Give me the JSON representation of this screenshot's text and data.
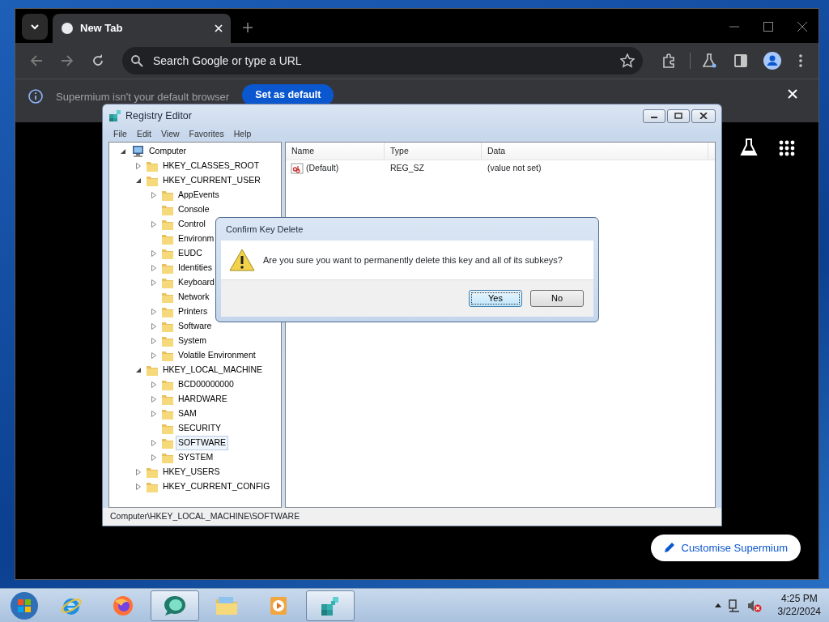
{
  "browser": {
    "tabs": [
      {
        "label": "New Tab",
        "selected": true
      }
    ],
    "omnibox": {
      "placeholder": "Search Google or type a URL"
    },
    "infobar": {
      "message": "Supermium isn't your default browser",
      "button": "Set as default"
    },
    "customise_button": "Customise Supermium"
  },
  "regedit": {
    "title": "Registry Editor",
    "menu": [
      "File",
      "Edit",
      "View",
      "Favorites",
      "Help"
    ],
    "tree": [
      {
        "label": "Computer",
        "kind": "computer",
        "expanded": true,
        "selected": false,
        "children": [
          {
            "label": "HKEY_CLASSES_ROOT",
            "expanded": false,
            "selected": false
          },
          {
            "label": "HKEY_CURRENT_USER",
            "expanded": true,
            "selected": false,
            "children": [
              {
                "label": "AppEvents",
                "expanded": false,
                "selected": false
              },
              {
                "label": "Console",
                "selected": false
              },
              {
                "label": "Control",
                "expanded": false,
                "selected": false
              },
              {
                "label": "Environm",
                "selected": false
              },
              {
                "label": "EUDC",
                "expanded": false,
                "selected": false
              },
              {
                "label": "Identities",
                "expanded": false,
                "selected": false
              },
              {
                "label": "Keyboard",
                "expanded": false,
                "selected": false
              },
              {
                "label": "Network",
                "selected": false
              },
              {
                "label": "Printers",
                "expanded": false,
                "selected": false
              },
              {
                "label": "Software",
                "expanded": false,
                "selected": false
              },
              {
                "label": "System",
                "expanded": false,
                "selected": false
              },
              {
                "label": "Volatile Environment",
                "expanded": false,
                "selected": false
              }
            ]
          },
          {
            "label": "HKEY_LOCAL_MACHINE",
            "expanded": true,
            "selected": false,
            "children": [
              {
                "label": "BCD00000000",
                "expanded": false,
                "selected": false
              },
              {
                "label": "HARDWARE",
                "expanded": false,
                "selected": false
              },
              {
                "label": "SAM",
                "expanded": false,
                "selected": false
              },
              {
                "label": "SECURITY",
                "selected": false
              },
              {
                "label": "SOFTWARE",
                "expanded": false,
                "selected": true
              },
              {
                "label": "SYSTEM",
                "expanded": false,
                "selected": false
              }
            ]
          },
          {
            "label": "HKEY_USERS",
            "expanded": false,
            "selected": false
          },
          {
            "label": "HKEY_CURRENT_CONFIG",
            "expanded": false,
            "selected": false
          }
        ]
      }
    ],
    "columns": [
      "Name",
      "Type",
      "Data"
    ],
    "rows": [
      {
        "name": "(Default)",
        "type": "REG_SZ",
        "data": "(value not set)"
      }
    ],
    "status_bar": "Computer\\HKEY_LOCAL_MACHINE\\SOFTWARE"
  },
  "dialog": {
    "title": "Confirm Key Delete",
    "message": "Are you sure you want to permanently delete this key and all of its subkeys?",
    "buttons": [
      {
        "label": "Yes",
        "default": true
      },
      {
        "label": "No",
        "default": false
      }
    ]
  },
  "taskbar": {
    "apps": [
      {
        "kind": "ie",
        "active": false
      },
      {
        "kind": "firefox",
        "active": false
      },
      {
        "kind": "chat",
        "active": true
      },
      {
        "kind": "explorer",
        "active": false
      },
      {
        "kind": "media",
        "active": false
      },
      {
        "kind": "regedit",
        "active": true
      }
    ],
    "time": "4:25 PM",
    "date": "3/22/2024"
  }
}
